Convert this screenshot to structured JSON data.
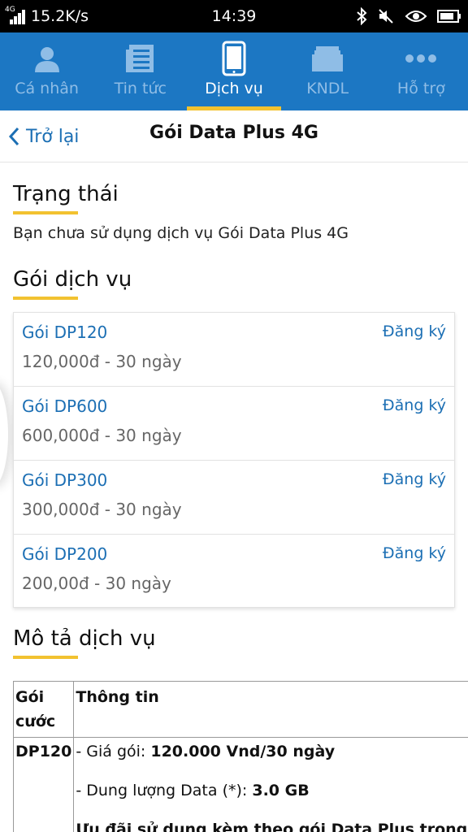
{
  "status_bar": {
    "network_type": "4G",
    "speed": "15.2K/s",
    "time": "14:39",
    "icons": [
      "bluetooth-icon",
      "mute-icon",
      "eye-icon",
      "battery-icon"
    ]
  },
  "nav": {
    "tabs": [
      {
        "label": "Cá nhân",
        "icon": "person-icon"
      },
      {
        "label": "Tin tức",
        "icon": "news-icon"
      },
      {
        "label": "Dịch vụ",
        "icon": "phone-icon",
        "active": true
      },
      {
        "label": "KNDL",
        "icon": "folder-icon"
      },
      {
        "label": "Hỗ trợ",
        "icon": "more-icon"
      }
    ],
    "colors": {
      "bar": "#1c77c3",
      "indicator": "#f2c230",
      "inactive": "#8fbde6"
    }
  },
  "header": {
    "back_label": "Trở lại",
    "title": "Gói Data Plus 4G"
  },
  "status_section": {
    "title": "Trạng thái",
    "text": "Bạn chưa sử dụng dịch vụ Gói Data Plus 4G"
  },
  "packages_section": {
    "title": "Gói dịch vụ",
    "packages": [
      {
        "name": "Gói DP120",
        "price": "120,000đ - 30 ngày",
        "action": "Đăng ký"
      },
      {
        "name": "Gói DP600",
        "price": "600,000đ - 30 ngày",
        "action": "Đăng ký"
      },
      {
        "name": "Gói DP300",
        "price": "300,000đ - 30 ngày",
        "action": "Đăng ký"
      },
      {
        "name": "Gói DP200",
        "price": "200,00đ - 30 ngày",
        "action": "Đăng ký"
      }
    ]
  },
  "description_section": {
    "title": "Mô tả dịch vụ",
    "table": {
      "header_col1_line1": "Gói",
      "header_col1_line2": "cước",
      "header_col2": "Thông tin",
      "row1_name": "DP120",
      "row1_price_label": "- Giá gói: ",
      "row1_price_value": "120.000 Vnd/30 ngày",
      "row1_data_label": "- Dung lượng Data (*): ",
      "row1_data_value": "3.0 GB",
      "row1_offer": "Ưu đãi sử dụng kèm theo gói Data Plus trong"
    }
  }
}
